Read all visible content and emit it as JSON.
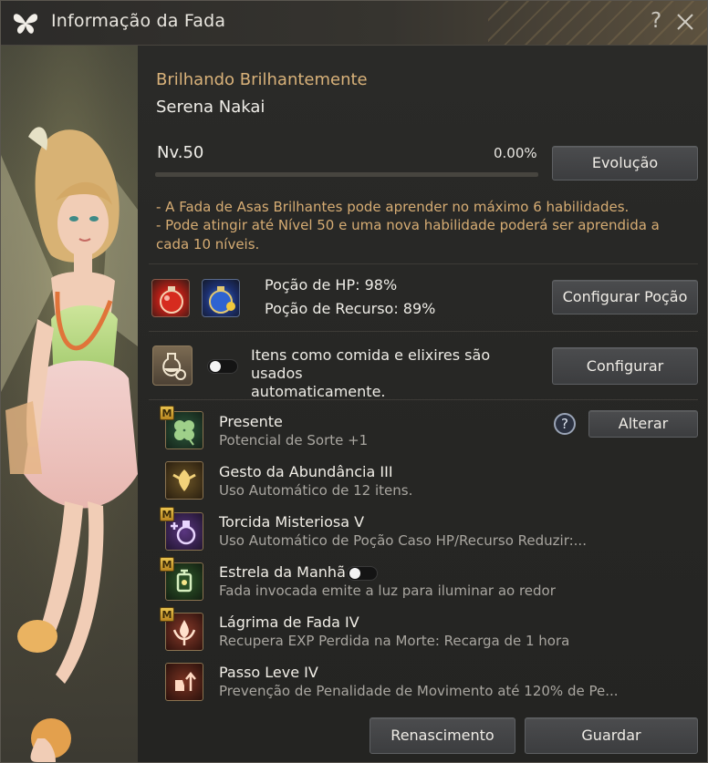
{
  "window": {
    "title": "Informação da Fada",
    "help_glyph": "?"
  },
  "fairy": {
    "title": "Brilhando Brilhantemente",
    "name": "Serena Nakai",
    "level": "Nv.50",
    "exp_percent": "0.00%",
    "exp_fraction": 0.0,
    "evolution_button": "Evolução",
    "notes": [
      "- A Fada de Asas Brilhantes pode aprender no máximo 6 habilidades.",
      "- Pode atingir até Nível 50 e uma nova habilidade poderá ser aprendida a",
      "cada 10 níveis."
    ]
  },
  "potions": {
    "hp_label": "Poção de HP: 98%",
    "resource_label": "Poção de Recurso: 89%",
    "configure_button": "Configurar Poção"
  },
  "auto_use": {
    "text_line1": "Itens como comida e elixires são usados",
    "text_line2": "automaticamente.",
    "toggle_on": false,
    "configure_button": "Configurar"
  },
  "skills": {
    "help_glyph": "?",
    "change_button": "Alterar",
    "badge": "M",
    "items": [
      {
        "name": "Presente",
        "desc": "Potencial de Sorte +1",
        "icon": "clover-icon",
        "badge": true
      },
      {
        "name": "Gesto da Abundância III",
        "desc": "Uso Automático de 12 itens.",
        "icon": "fairy-gesture-icon",
        "badge": false
      },
      {
        "name": "Torcida Misteriosa V",
        "desc": "Uso Automático de Poção Caso HP/Recurso Reduzir:...",
        "icon": "potion-cheer-icon",
        "badge": true
      },
      {
        "name": "Estrela da Manhã",
        "desc": "Fada invocada emite a luz para iluminar ao redor",
        "icon": "lantern-icon",
        "badge": true,
        "toggle_on": false
      },
      {
        "name": "Lágrima de Fada IV",
        "desc": "Recupera EXP Perdida na Morte: Recarga de 1 hora",
        "icon": "fairy-tear-icon",
        "badge": true
      },
      {
        "name": "Passo Leve IV",
        "desc": "Prevenção de Penalidade de Movimento até 120% de Pe...",
        "icon": "light-step-icon",
        "badge": false
      }
    ]
  },
  "footer": {
    "rebirth_button": "Renascimento",
    "save_button": "Guardar"
  },
  "colors": {
    "accent_gold": "#d9b27a",
    "note_gold": "#d6ac73",
    "bar_bg": "#47453f"
  }
}
